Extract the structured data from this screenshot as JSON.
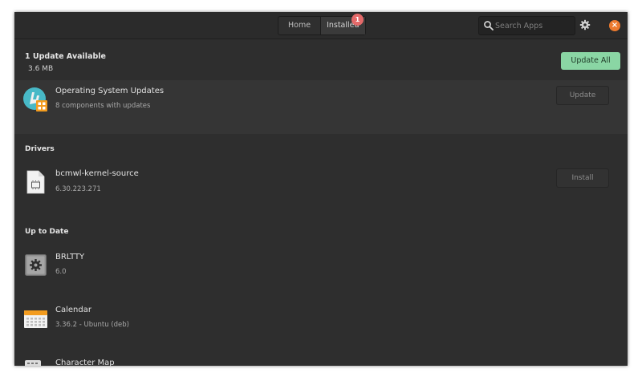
{
  "header": {
    "tabs": [
      {
        "label": "Home"
      },
      {
        "label": "Installed"
      }
    ],
    "badge_count": "1",
    "search_placeholder": "Search Apps"
  },
  "updates": {
    "title": "1 Update Available",
    "size": "3.6 MB",
    "update_all_label": "Update All",
    "item": {
      "name": "Operating System Updates",
      "detail": "8 components with updates",
      "action": "Update"
    }
  },
  "drivers": {
    "title": "Drivers",
    "item": {
      "name": "bcmwl-kernel-source",
      "version": "6.30.223.271",
      "action": "Install"
    }
  },
  "up_to_date": {
    "title": "Up to Date",
    "items": [
      {
        "name": "BRLTTY",
        "version": "6.0"
      },
      {
        "name": "Calendar",
        "version": "3.36.2 - Ubuntu (deb)"
      },
      {
        "name": "Character Map",
        "version": ""
      }
    ]
  },
  "colors": {
    "accent_green": "#8ad6a4",
    "close_orange": "#ec7a2e",
    "badge_red": "#e46a6a",
    "window_bg": "#2e2e2e"
  }
}
